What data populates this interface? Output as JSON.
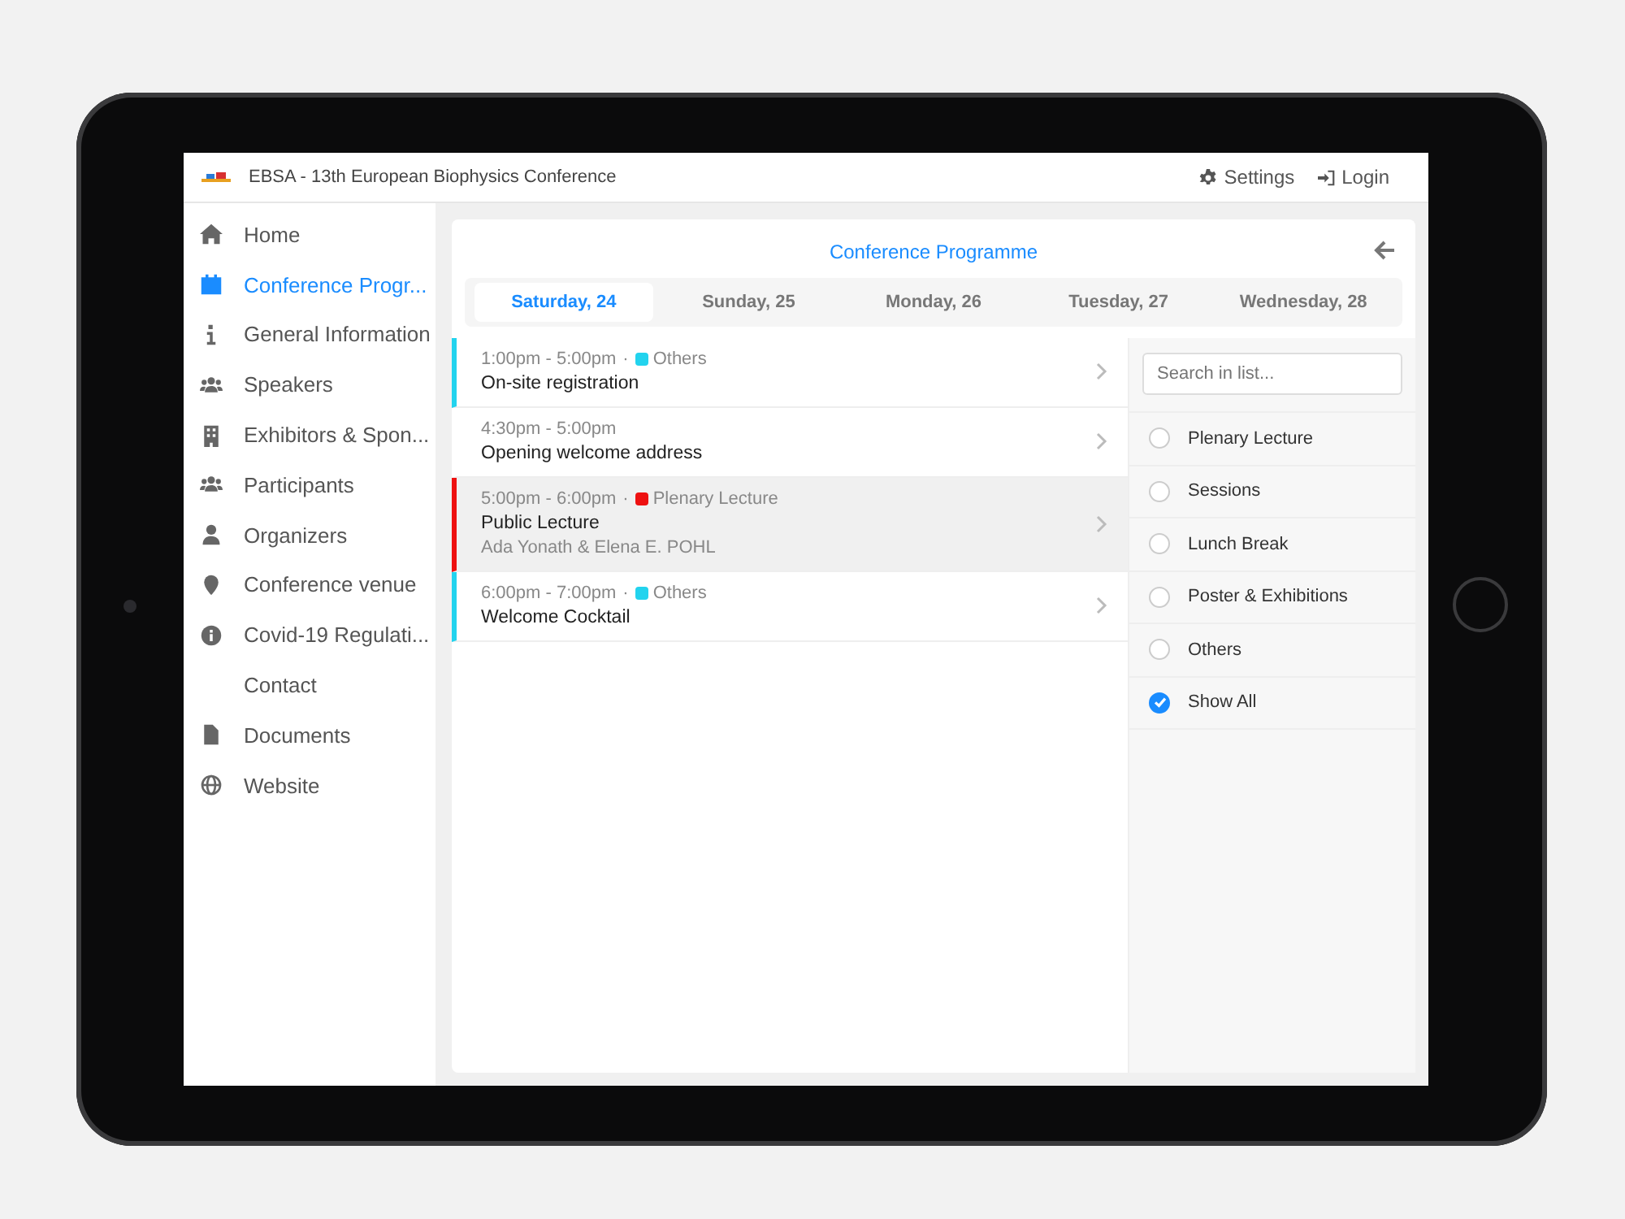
{
  "header": {
    "title": "EBSA - 13th European Biophysics Conference",
    "actions": [
      {
        "label": "Settings"
      },
      {
        "label": "Login"
      }
    ]
  },
  "sidebar": {
    "items": [
      {
        "label": "Home",
        "selected": false
      },
      {
        "label": "Conference Progr...",
        "selected": true
      },
      {
        "label": "General Information",
        "selected": false
      },
      {
        "label": "Speakers",
        "selected": false
      },
      {
        "label": "Exhibitors & Spon...",
        "selected": false
      },
      {
        "label": "Participants",
        "selected": false
      },
      {
        "label": "Organizers",
        "selected": false
      },
      {
        "label": "Conference venue",
        "selected": false
      },
      {
        "label": "Covid-19 Regulati...",
        "selected": false
      },
      {
        "label": "Contact",
        "selected": false
      },
      {
        "label": "Documents",
        "selected": false
      },
      {
        "label": "Website",
        "selected": false
      }
    ]
  },
  "programme": {
    "title": "Conference Programme",
    "tabs": [
      {
        "label": "Saturday, 24",
        "selected": true
      },
      {
        "label": "Sunday, 25",
        "selected": false
      },
      {
        "label": "Monday, 26",
        "selected": false
      },
      {
        "label": "Tuesday, 27",
        "selected": false
      },
      {
        "label": "Wednesday, 28",
        "selected": false
      }
    ],
    "events": [
      {
        "time": "1:00pm - 5:00pm",
        "separator": "·",
        "category": "Others",
        "color": "#22d3ee",
        "title": "On-site registration",
        "selected": false
      },
      {
        "time": "4:30pm - 5:00pm",
        "title": "Opening welcome address",
        "selected": false
      },
      {
        "time": "5:00pm - 6:00pm",
        "separator": "·",
        "category": "Plenary Lecture",
        "color": "#ee1111",
        "title": "Public Lecture",
        "speakers": "Ada Yonath & Elena E. POHL",
        "selected": true
      },
      {
        "time": "6:00pm - 7:00pm",
        "separator": "·",
        "category": "Others",
        "color": "#22d3ee",
        "title": "Welcome Cocktail",
        "selected": false
      }
    ],
    "filter": {
      "search": {
        "placeholder": "Search in list..."
      },
      "options": [
        {
          "label": "Plenary Lecture",
          "checked": false
        },
        {
          "label": "Sessions",
          "checked": false
        },
        {
          "label": "Lunch Break",
          "checked": false
        },
        {
          "label": "Poster & Exhibitions",
          "checked": false
        },
        {
          "label": "Others",
          "checked": false
        },
        {
          "label": "Show All",
          "checked": true
        }
      ]
    }
  }
}
